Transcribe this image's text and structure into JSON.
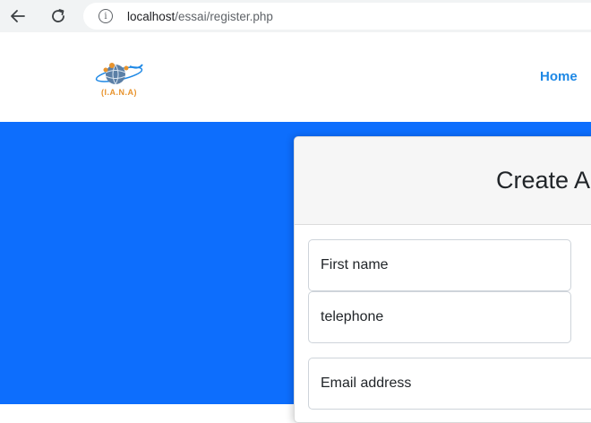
{
  "browser": {
    "url_host": "localhost",
    "url_path": "/essai/register.php"
  },
  "header": {
    "logo_text": "(I.A.N.A)",
    "nav_home": "Home"
  },
  "card": {
    "title": "Create A",
    "fields": [
      {
        "placeholder": "First name"
      },
      {
        "placeholder": "telephone"
      },
      {
        "placeholder": "Email address"
      }
    ]
  },
  "colors": {
    "hero_blue": "#0d6efd",
    "link_blue": "#1e88e5",
    "logo_orange": "#e8932c"
  },
  "icons": [
    "back-arrow-icon",
    "reload-icon",
    "info-icon",
    "globe-logo"
  ]
}
